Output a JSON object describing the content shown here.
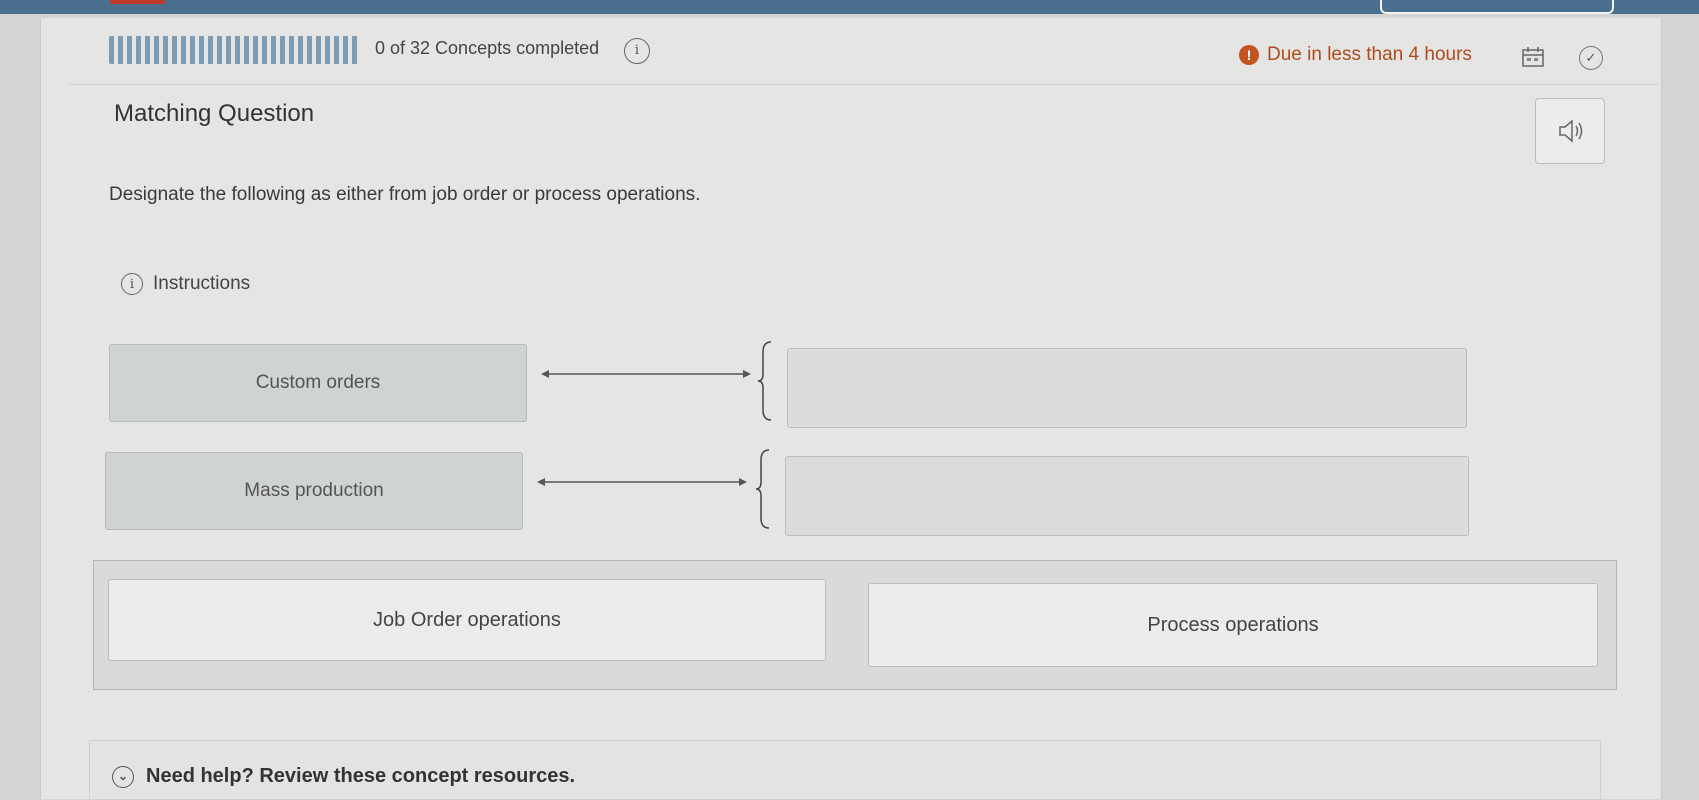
{
  "header": {
    "progress_text": "0 of 32  Concepts completed",
    "progress_value": 0,
    "progress_total": 32,
    "due_text": "Due in less than 4 hours",
    "due_color": "#b24a1c"
  },
  "question": {
    "title": "Matching Question",
    "prompt": "Designate the following as either from job order or process operations.",
    "instructions_label": "Instructions"
  },
  "terms": [
    {
      "label": "Custom orders"
    },
    {
      "label": "Mass production"
    }
  ],
  "choices": [
    {
      "label": "Job Order operations"
    },
    {
      "label": "Process operations"
    }
  ],
  "help": {
    "label": "Need help? Review these concept resources."
  },
  "icons": {
    "info": "i",
    "due_alert": "!",
    "check": "✓"
  },
  "colors": {
    "topbar": "#4a6f8e",
    "progress": "#6b8fae"
  }
}
